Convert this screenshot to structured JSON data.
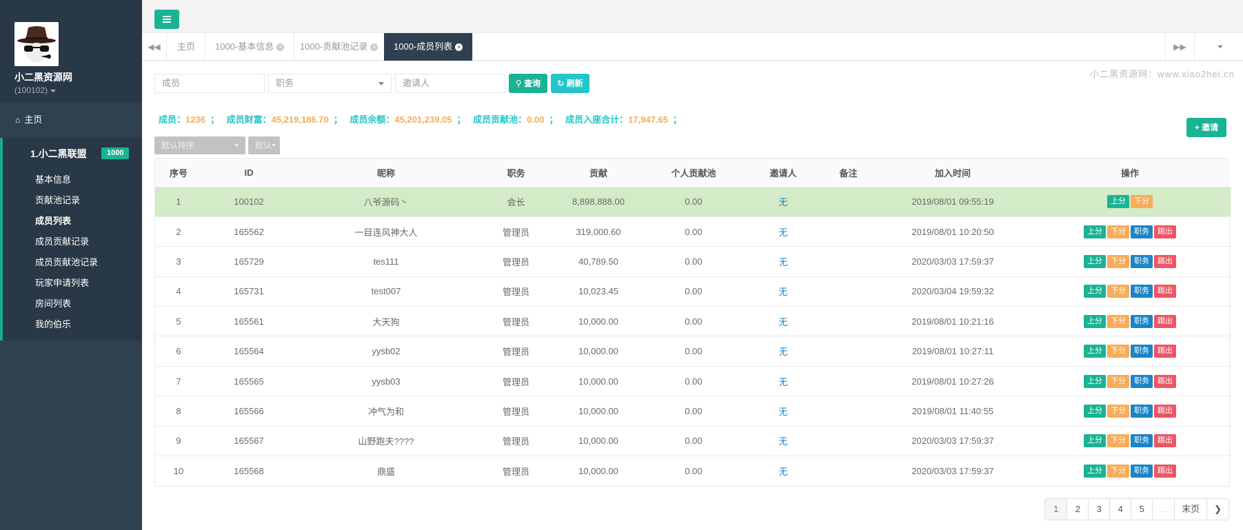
{
  "sidebar": {
    "brand": "小二黑资源网",
    "account_id": "(100102)",
    "home": "主页",
    "group_title": "1.小二黑联盟",
    "group_badge": "1000",
    "items": [
      "基本信息",
      "贡献池记录",
      "成员列表",
      "成员贡献记录",
      "成员贡献池记录",
      "玩家申请列表",
      "房间列表",
      "我的伯乐"
    ]
  },
  "tabs": [
    "主页",
    "1000-基本信息",
    "1000-贡献池记录",
    "1000-成员列表"
  ],
  "watermark": "小二黑资源网：www.xiao2hei.cn",
  "filters": {
    "member_placeholder": "成员",
    "role_placeholder": "职务",
    "inviter_placeholder": "邀请人",
    "query_label": "查询",
    "refresh_label": "刷新"
  },
  "summary": {
    "members_label": "成员：",
    "members_value": "1236",
    "wealth_label": "成员财富：",
    "wealth_value": "45,219,186.70",
    "balance_label": "成员余额：",
    "balance_value": "45,201,239.05",
    "pool_label": "成员贡献池：",
    "pool_value": "0.00",
    "seat_label": "成员入座合计：",
    "seat_value": "17,947.65",
    "sep": "；"
  },
  "toolbar": {
    "sort_label": "默认排序",
    "order_label": "默认",
    "invite_label": "邀请"
  },
  "table": {
    "headers": [
      "序号",
      "ID",
      "昵称",
      "职务",
      "贡献",
      "个人贡献池",
      "邀请人",
      "备注",
      "加入时间",
      "操作"
    ],
    "rows": [
      {
        "no": "1",
        "id": "100102",
        "nick": "八爷源码丶",
        "role": "会长",
        "contrib": "8,898,888.00",
        "pool": "0.00",
        "inviter": "无",
        "note": "",
        "time": "2019/08/01 09:55:19"
      },
      {
        "no": "2",
        "id": "165562",
        "nick": "一目连风神大人",
        "role": "管理员",
        "contrib": "319,000.60",
        "pool": "0.00",
        "inviter": "无",
        "note": "",
        "time": "2019/08/01 10:20:50"
      },
      {
        "no": "3",
        "id": "165729",
        "nick": "tes111",
        "role": "管理员",
        "contrib": "40,789.50",
        "pool": "0.00",
        "inviter": "无",
        "note": "",
        "time": "2020/03/03 17:59:37"
      },
      {
        "no": "4",
        "id": "165731",
        "nick": "test007",
        "role": "管理员",
        "contrib": "10,023.45",
        "pool": "0.00",
        "inviter": "无",
        "note": "",
        "time": "2020/03/04 19:59:32"
      },
      {
        "no": "5",
        "id": "165561",
        "nick": "大天狗",
        "role": "管理员",
        "contrib": "10,000.00",
        "pool": "0.00",
        "inviter": "无",
        "note": "",
        "time": "2019/08/01 10:21:16"
      },
      {
        "no": "6",
        "id": "165564",
        "nick": "yysb02",
        "role": "管理员",
        "contrib": "10,000.00",
        "pool": "0.00",
        "inviter": "无",
        "note": "",
        "time": "2019/08/01 10:27:11"
      },
      {
        "no": "7",
        "id": "165565",
        "nick": "yysb03",
        "role": "管理员",
        "contrib": "10,000.00",
        "pool": "0.00",
        "inviter": "无",
        "note": "",
        "time": "2019/08/01 10:27:26"
      },
      {
        "no": "8",
        "id": "165566",
        "nick": "冲气为和",
        "role": "管理员",
        "contrib": "10,000.00",
        "pool": "0.00",
        "inviter": "无",
        "note": "",
        "time": "2019/08/01 11:40:55"
      },
      {
        "no": "9",
        "id": "165567",
        "nick": "山野跑夫????",
        "role": "管理员",
        "contrib": "10,000.00",
        "pool": "0.00",
        "inviter": "无",
        "note": "",
        "time": "2020/03/03 17:59:37"
      },
      {
        "no": "10",
        "id": "165568",
        "nick": "鼎盛",
        "role": "管理员",
        "contrib": "10,000.00",
        "pool": "0.00",
        "inviter": "无",
        "note": "",
        "time": "2020/03/03 17:59:37"
      }
    ],
    "actions": {
      "up": "上分",
      "down": "下分",
      "role": "职务",
      "kick": "踢出"
    }
  },
  "pagination": {
    "pages": [
      "1",
      "2",
      "3",
      "4",
      "5"
    ],
    "ellipsis": "...",
    "last": "末页",
    "current": "1"
  }
}
